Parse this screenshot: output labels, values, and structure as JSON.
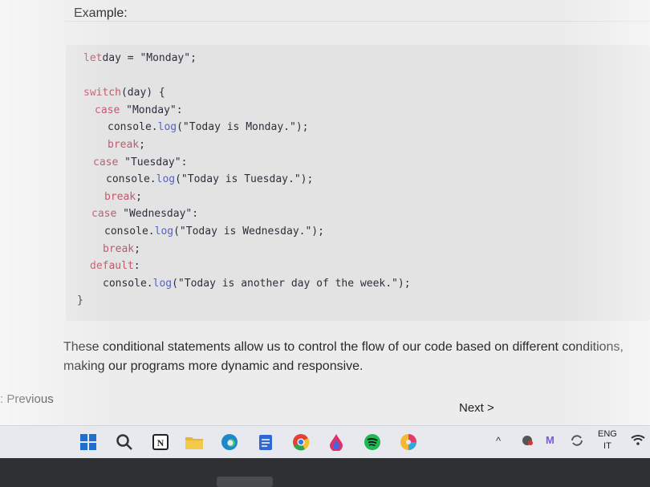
{
  "page": {
    "heading": "Example:",
    "paragraph": "These conditional statements allow us to control the flow of our code based on different conditions, making our programs more dynamic and responsive."
  },
  "code": [
    [
      {
        "t": "let",
        "c": "kw"
      },
      {
        "t": " day = ",
        "c": "plain"
      },
      {
        "t": "\"Monday\"",
        "c": "str"
      },
      {
        "t": ";",
        "c": "plain"
      }
    ],
    [],
    [
      {
        "t": "switch",
        "c": "kw"
      },
      {
        "t": " (day) {",
        "c": "plain"
      }
    ],
    [
      {
        "t": "  case ",
        "c": "kw"
      },
      {
        "t": "\"Monday\"",
        "c": "str"
      },
      {
        "t": ":",
        "c": "plain"
      }
    ],
    [
      {
        "t": "    console.",
        "c": "plain"
      },
      {
        "t": "log",
        "c": "fn"
      },
      {
        "t": "(\"Today is Monday.\");",
        "c": "str"
      }
    ],
    [
      {
        "t": "    break",
        "c": "kw"
      },
      {
        "t": ";",
        "c": "plain"
      }
    ],
    [
      {
        "t": "  case ",
        "c": "kw"
      },
      {
        "t": "\"Tuesday\"",
        "c": "str"
      },
      {
        "t": ":",
        "c": "plain"
      }
    ],
    [
      {
        "t": "    console.",
        "c": "plain"
      },
      {
        "t": "log",
        "c": "fn"
      },
      {
        "t": "(\"Today is Tuesday.\");",
        "c": "str"
      }
    ],
    [
      {
        "t": "    break",
        "c": "kw"
      },
      {
        "t": ";",
        "c": "plain"
      }
    ],
    [
      {
        "t": "  case ",
        "c": "kw"
      },
      {
        "t": "\"Wednesday\"",
        "c": "str"
      },
      {
        "t": ":",
        "c": "plain"
      }
    ],
    [
      {
        "t": "    console.",
        "c": "plain"
      },
      {
        "t": "log",
        "c": "fn"
      },
      {
        "t": "(\"Today is Wednesday.\");",
        "c": "str"
      }
    ],
    [
      {
        "t": "    break",
        "c": "kw"
      },
      {
        "t": ";",
        "c": "plain"
      }
    ],
    [
      {
        "t": "  default",
        "c": "kw"
      },
      {
        "t": ":",
        "c": "plain"
      }
    ],
    [
      {
        "t": "    console.",
        "c": "plain"
      },
      {
        "t": "log",
        "c": "fn"
      },
      {
        "t": "(\"Today is another day of the week.\");",
        "c": "str"
      }
    ],
    [
      {
        "t": "}",
        "c": "plain"
      }
    ]
  ],
  "nav": {
    "previous_label": ": Previous",
    "next_label": "Next >"
  },
  "taskbar": {
    "apps": [
      {
        "icon": "windows-start-icon",
        "color": "#1f6fd0"
      },
      {
        "icon": "search-icon",
        "color": "#333333"
      },
      {
        "icon": "notion-icon",
        "color": "#222222"
      },
      {
        "icon": "file-explorer-icon",
        "color": "#e8b630"
      },
      {
        "icon": "edge-icon",
        "color": "#1e88c8"
      },
      {
        "icon": "notepad-icon",
        "color": "#2f67d8"
      },
      {
        "icon": "chrome-icon",
        "color": "#e34133"
      },
      {
        "icon": "drop-app-icon",
        "color": "#e0306a"
      },
      {
        "icon": "spotify-icon",
        "color": "#1db954"
      },
      {
        "icon": "color-app-icon",
        "color": "#e23b6d"
      }
    ],
    "tray": {
      "chevron": "^",
      "language_top": "ENG",
      "language_bottom": "IT"
    }
  },
  "colors": {
    "keyword": "#c4566c",
    "function": "#5a63b8",
    "code_background": "#e3e3e3"
  }
}
